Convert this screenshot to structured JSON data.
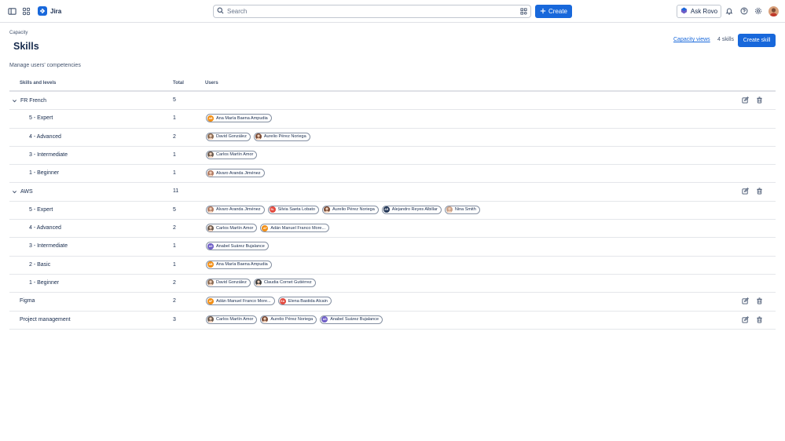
{
  "app": {
    "name": "Jira"
  },
  "search": {
    "placeholder": "Search"
  },
  "topbar": {
    "create_label": "Create",
    "rovo_label": "Ask Rovo"
  },
  "page": {
    "breadcrumb": "Capacity",
    "title": "Skills",
    "subtitle": "Manage users' competencies",
    "capacity_link": "Capacity views",
    "skill_count": "4 skills",
    "create_skill_label": "Create skill"
  },
  "table": {
    "headers": {
      "skill": "Skills and levels",
      "total": "Total",
      "users": "Users"
    }
  },
  "rows": [
    {
      "level": 0,
      "expand": true,
      "label": "FR French",
      "total": "5",
      "actions": true,
      "users": []
    },
    {
      "level": 1,
      "label": "5 - Expert",
      "total": "1",
      "users": [
        {
          "name": "Ana María Baena Ampudia",
          "initials": "AB",
          "color": "#f18d13"
        }
      ]
    },
    {
      "level": 1,
      "label": "4 - Advanced",
      "total": "2",
      "users": [
        {
          "name": "David González",
          "initials": "",
          "color": "#8a6a52"
        },
        {
          "name": "Aurelio Pérez Noriega",
          "initials": "",
          "color": "#7a4a34"
        }
      ]
    },
    {
      "level": 1,
      "label": "3 - Intermediate",
      "total": "1",
      "users": [
        {
          "name": "Carlos Martín Amor",
          "initials": "",
          "color": "#6b5a4e"
        }
      ]
    },
    {
      "level": 1,
      "label": "1 - Beginner",
      "total": "1",
      "users": [
        {
          "name": "Alvaro Aranda Jiménez",
          "initials": "",
          "color": "#b07a62"
        }
      ]
    },
    {
      "level": 0,
      "expand": true,
      "label": "AWS",
      "total": "11",
      "actions": true,
      "users": []
    },
    {
      "level": 1,
      "label": "5 - Expert",
      "total": "5",
      "users": [
        {
          "name": "Alvaro Aranda Jiménez",
          "initials": "",
          "color": "#b07a62"
        },
        {
          "name": "Silvia Saeta Lobato",
          "initials": "SL",
          "color": "#e2483d"
        },
        {
          "name": "Aurelio Pérez Noriega",
          "initials": "",
          "color": "#7a4a34"
        },
        {
          "name": "Alejandro Reyes Albillar",
          "initials": "AR",
          "color": "#253858"
        },
        {
          "name": "Nina Smith",
          "initials": "",
          "color": "#c9a087"
        }
      ]
    },
    {
      "level": 1,
      "label": "4 - Advanced",
      "total": "2",
      "users": [
        {
          "name": "Carlos Martín Amor",
          "initials": "",
          "color": "#6b5a4e"
        },
        {
          "name": "Adán Manuel Franco More...",
          "initials": "AF",
          "color": "#f18d13"
        }
      ]
    },
    {
      "level": 1,
      "label": "3 - Intermediate",
      "total": "1",
      "users": [
        {
          "name": "Anabel Suárez Bujalance",
          "initials": "AS",
          "color": "#6e5dc6"
        }
      ]
    },
    {
      "level": 1,
      "label": "2 - Basic",
      "total": "1",
      "users": [
        {
          "name": "Ana María Baena Ampudia",
          "initials": "AB",
          "color": "#f18d13"
        }
      ]
    },
    {
      "level": 1,
      "label": "1 - Beginner",
      "total": "2",
      "users": [
        {
          "name": "David González",
          "initials": "",
          "color": "#8a6a52"
        },
        {
          "name": "Claudia Cornet Gutiérrez",
          "initials": "",
          "color": "#3b3b3b"
        }
      ]
    },
    {
      "level": 0,
      "expand": false,
      "label": "Figma",
      "total": "2",
      "actions": true,
      "users": [
        {
          "name": "Adán Manuel Franco More...",
          "initials": "AF",
          "color": "#f18d13"
        },
        {
          "name": "Elena Bastida Alcain",
          "initials": "EA",
          "color": "#e2483d"
        }
      ]
    },
    {
      "level": 0,
      "expand": false,
      "label": "Project management",
      "total": "3",
      "actions": true,
      "users": [
        {
          "name": "Carlos Martín Amor",
          "initials": "",
          "color": "#6b5a4e"
        },
        {
          "name": "Aurelio Pérez Noriega",
          "initials": "",
          "color": "#7a4a34"
        },
        {
          "name": "Anabel Suárez Bujalance",
          "initials": "AS",
          "color": "#6e5dc6"
        }
      ]
    }
  ],
  "colors": {
    "brand": "#1868db",
    "text": "#172b4d",
    "border": "#dfe1e6"
  },
  "icons": [
    "sidebar-toggle-icon",
    "app-switcher-icon",
    "jira-logo-icon",
    "search-icon",
    "filter-icon",
    "plus-icon",
    "rovo-icon",
    "bell-icon",
    "help-icon",
    "gear-icon",
    "chevron-down-icon",
    "edit-icon",
    "trash-icon"
  ]
}
